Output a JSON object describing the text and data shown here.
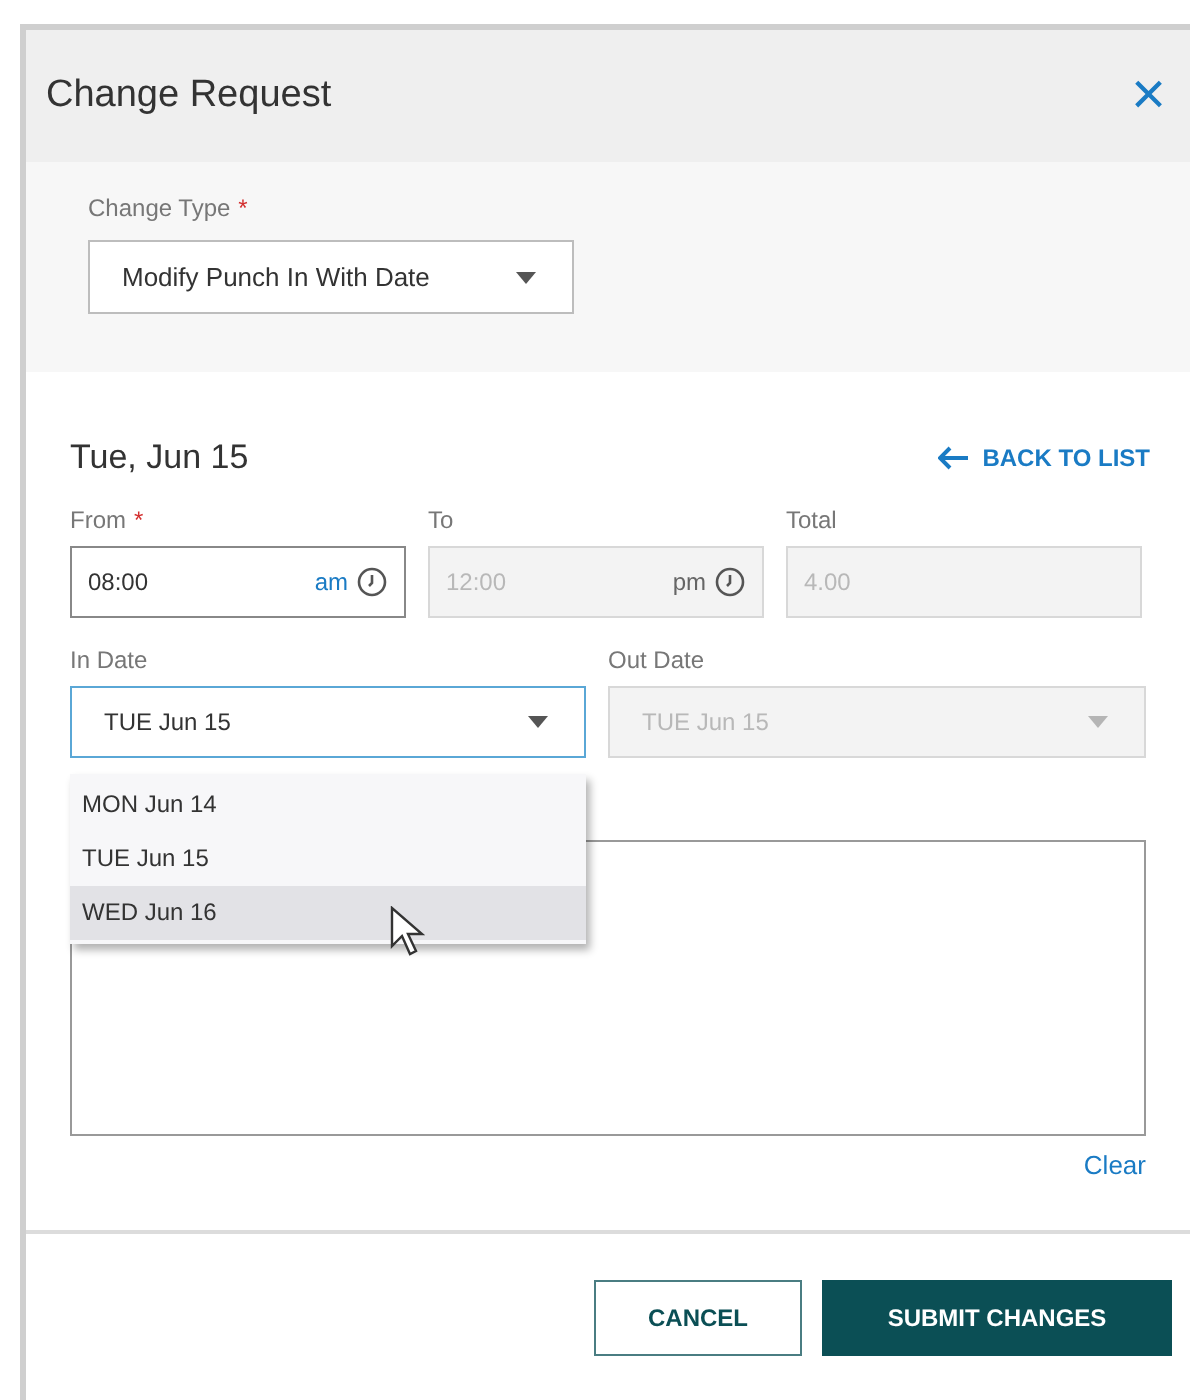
{
  "dialog": {
    "title": "Change Request",
    "close": "×"
  },
  "change_type": {
    "label": "Change Type",
    "required_mark": "*",
    "value": "Modify Punch In With Date"
  },
  "date_heading": "Tue, Jun 15",
  "back_link": "BACK TO LIST",
  "time_fields": [
    {
      "label": "From",
      "required_mark": "*",
      "value": "08:00",
      "suffix": "am",
      "kind": "time",
      "disabled": false
    },
    {
      "label": "To",
      "value": "12:00",
      "suffix": "pm",
      "kind": "time",
      "disabled": true
    },
    {
      "label": "Total",
      "value": "4.00",
      "kind": "number",
      "disabled": true
    }
  ],
  "date_fields": [
    {
      "label": "In Date",
      "value": "TUE Jun 15",
      "disabled": false,
      "focused": true
    },
    {
      "label": "Out Date",
      "value": "TUE Jun 15",
      "disabled": true,
      "focused": false
    }
  ],
  "date_menu": [
    {
      "label": "MON Jun 14",
      "hovered": false
    },
    {
      "label": "TUE Jun 15",
      "hovered": false
    },
    {
      "label": "WED Jun 16",
      "hovered": true
    }
  ],
  "clear_link": "Clear",
  "buttons": [
    {
      "label": "CANCEL",
      "kind": "secondary"
    },
    {
      "label": "SUBMIT CHANGES",
      "kind": "primary"
    }
  ]
}
